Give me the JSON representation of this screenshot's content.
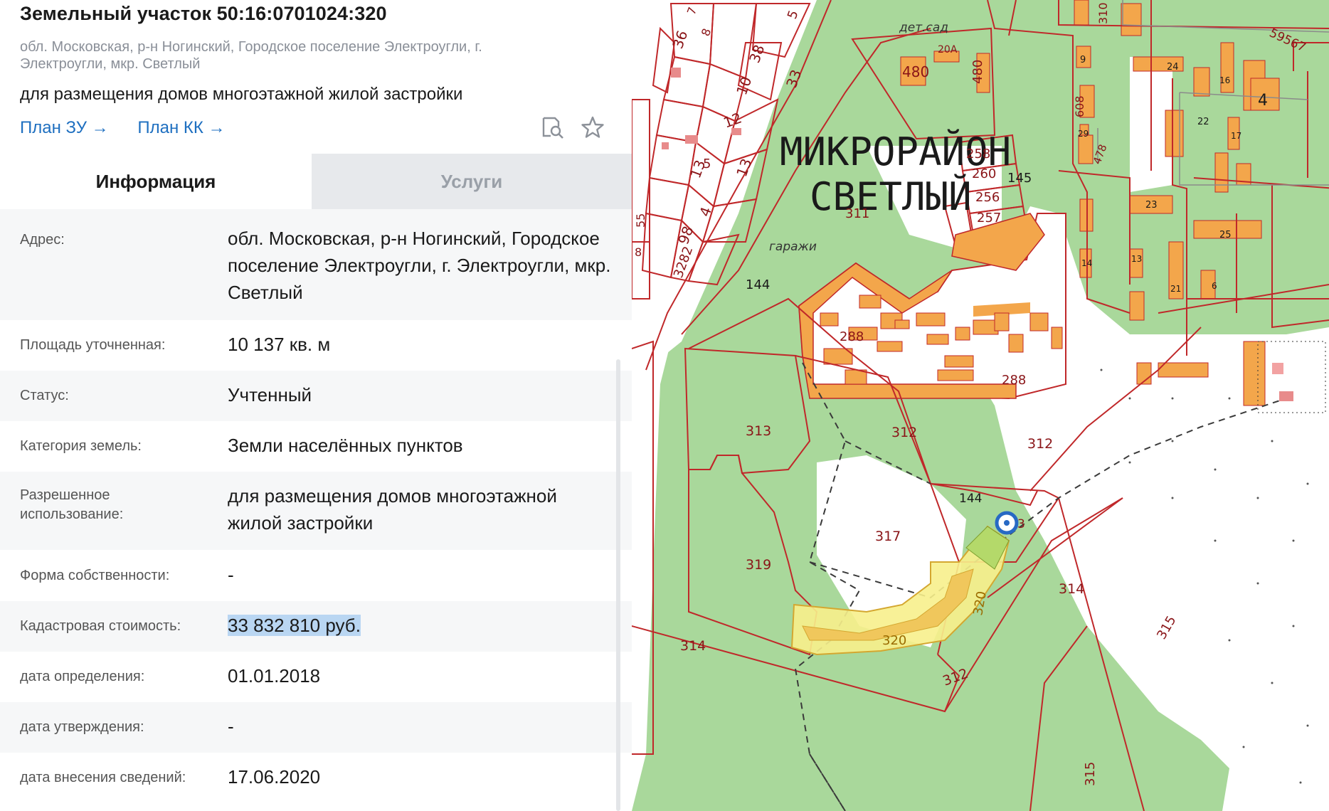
{
  "header": {
    "title": "Земельный участок 50:16:0701024:320",
    "address_short": "обл. Московская, р-н Ногинский, Городское поселение Электроугли, г. Электроугли, мкр. Светлый",
    "purpose": "для размещения домов многоэтажной жилой застройки",
    "link_plan_zu": "План ЗУ →",
    "link_plan_kk": "План КК →",
    "icons": [
      "document-search-icon",
      "star-icon"
    ]
  },
  "tabs": [
    {
      "label": "Информация",
      "active": true
    },
    {
      "label": "Услуги",
      "active": false
    }
  ],
  "info": [
    {
      "label": "Адрес:",
      "value": "обл. Московская, р-н Ногинский, Городское поселение Электроугли, г. Электроугли, мкр. Светлый"
    },
    {
      "label": "Площадь уточненная:",
      "value": "10 137 кв. м"
    },
    {
      "label": "Статус:",
      "value": "Учтенный"
    },
    {
      "label": "Категория земель:",
      "value": "Земли населённых пунктов"
    },
    {
      "label": "Разрешенное использование:",
      "value": "для размещения домов многоэтажной жилой застройки"
    },
    {
      "label": "Форма собственности:",
      "value": "-"
    },
    {
      "label": "Кадастровая стоимость:",
      "value": "33 832 810 руб.",
      "highlighted": true
    },
    {
      "label": "дата определения:",
      "value": "01.01.2018"
    },
    {
      "label": "дата утверждения:",
      "value": "-"
    },
    {
      "label": "дата внесения сведений:",
      "value": "17.06.2020"
    }
  ],
  "map": {
    "district_line1": "МИКРОРАЙОН",
    "district_line2": "СВЕТЛЫЙ",
    "labels": {
      "det_sad": "дет.сад",
      "garazhi": "гаражи",
      "p480a": "480",
      "p480b": "480",
      "p20a": "20А",
      "p36": "36",
      "p8": "8",
      "p7": "7",
      "p5": "5",
      "p38": "38",
      "p10": "10",
      "p33": "33",
      "p12": "12",
      "p13a": "13",
      "p13b": "13",
      "p4": "4",
      "p98": "98",
      "p3282": "3282",
      "p55": "55",
      "p8b": "8",
      "p258": "258",
      "p260": "260",
      "p256": "256",
      "p257": "257",
      "p145": "145",
      "p311": "311",
      "p144a": "144",
      "p288a": "288",
      "p288b": "288",
      "p313": "313",
      "p312a": "312",
      "p312b": "312",
      "p312c": "312",
      "p317": "317",
      "p319": "319",
      "p320a": "320",
      "p320b": "320",
      "p314a": "314",
      "p314b": "314",
      "p315a": "315",
      "p315b": "315",
      "p144b": "144",
      "p3": "3",
      "p310": "310",
      "p59567": "59567",
      "p9": "9",
      "p24": "24",
      "p16": "16",
      "p4b": "4",
      "p608": "608",
      "p22": "22",
      "p29": "29",
      "p478": "478",
      "p17": "17",
      "p23": "23",
      "p25": "25",
      "p13c": "13",
      "p14": "14",
      "p21": "21",
      "p6": "6"
    },
    "colors": {
      "green": "#a9d89b",
      "white_area": "#ffffff",
      "boundary": "#c0282a",
      "building": "#f3a64b",
      "selected_parcel": "#f7ef8c"
    }
  }
}
